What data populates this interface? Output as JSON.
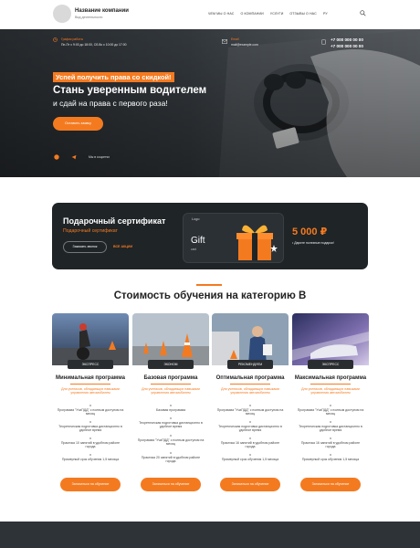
{
  "header": {
    "company_name": "Название компании",
    "company_sub": "Вид деятельности",
    "nav": [
      "ЧЕМ МЫ О НАС",
      "О КОМПАНИИ",
      "УСЛУГИ",
      "ОТЗЫВЫ О НАС"
    ],
    "lang": "РУ"
  },
  "hero": {
    "schedule_label": "График работы",
    "schedule_value": "Пн-Пт с 9:00 до 18:00, Сб-Вс с 10:00 до 17:00",
    "email_label": "Email",
    "email_value": "mail@example.com",
    "phone1": "+7 000 000 00 00",
    "phone2": "+7 000 000 00 00",
    "badge": "Успей получить права со скидкой!",
    "title": "Стань уверенным водителем",
    "subtitle": "и сдай на права с первого раза!",
    "cta": "Оставить заявку",
    "cert_link": "Мы в соцсетях"
  },
  "gift": {
    "title": "Подарочный сертификат",
    "subtitle": "Подарочный сертификат",
    "btn_call": "Заказать звонок",
    "btn_more": "ВСЕ АКЦИИ",
    "card_logo": "Logo",
    "card_gift": "Gift",
    "card_card": "card",
    "price": "5 000 ₽",
    "note": "• Дарите полезные подарки!"
  },
  "pricing": {
    "title": "Стоимость обучения на категорию В",
    "button_label": "Записаться на обучение",
    "cards": [
      {
        "tag": "ЭКСПРЕСС",
        "name": "Минимальная программа",
        "desc": "Для учеников, обладающих навыками управления автомобилем",
        "features": [
          "Программа \"УчиПДД\" с полным доступом на месяц",
          "Теоретическая подготовка дистанционно в удобное время",
          "Практика 10 занятий в удобном районе города",
          "Примерный срок обучения 1,5 месяца"
        ]
      },
      {
        "tag": "ЭКОНОМ",
        "name": "Базовая программа",
        "desc": "Для учеников, обладающих навыками управления автомобилем",
        "features": [
          "Базовая программа",
          "Теоретическая подготовка дистанционно в удобное время",
          "Программа \"УчиПДД\" с полным доступом на месяц",
          "Практика 20 занятий в удобном районе города"
        ]
      },
      {
        "tag": "РЕКОМЕНДУЕМ",
        "name": "Оптимальная программа",
        "desc": "Для учеников, обладающих навыками управления автомобилем",
        "features": [
          "Программа \"УчиПДД\" с полным доступом на месяц",
          "Теоретическая подготовка дистанционно в удобное время",
          "Практика 16 занятий в удобном районе города",
          "Примерный срок обучения 1,5 месяца"
        ]
      },
      {
        "tag": "ЭКСПРЕСС",
        "name": "Максимальная программа",
        "desc": "Для учеников, обладающих навыками управления автомобилем",
        "features": [
          "Программа \"УчиПДД\" с полным доступом на месяц",
          "Теоретическая подготовка дистанционно в удобное время",
          "Практика 16 занятий в удобном районе города",
          "Примерный срок обучения 1,5 месяца"
        ]
      }
    ]
  },
  "colors": {
    "accent": "#f47a20",
    "dark": "#1f2427"
  }
}
